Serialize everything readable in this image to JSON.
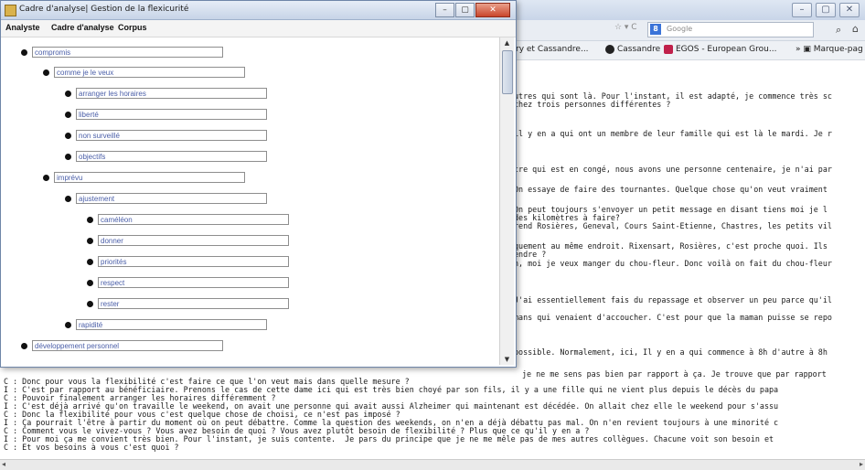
{
  "browser": {
    "window_controls": [
      "–",
      "▢",
      "✕"
    ],
    "url_tail": "☆ ▾ C",
    "search_placeholder": "Google",
    "bookmarks": [
      {
        "label": "ry et Cassandre...",
        "color": ""
      },
      {
        "label": "Cassandre",
        "color": "#222222"
      },
      {
        "label": "EGOS - European Grou...",
        "color": "#c0204a"
      },
      {
        "label": "» ▣ Marque-pag",
        "color": ""
      }
    ],
    "right_lines": [
      "utres qui sont là. Pour l'instant, il est adapté, je commence très sc",
      "chez trois personnes différentes ?",
      "il y en a qui ont un membre de leur famille qui est là le mardi. Je r",
      "tre qui est en congé, nous avons une personne centenaire, je n'ai par",
      "On essaye de faire des tournantes. Quelque chose qu'on veut vraiment",
      "On peut toujours s'envoyer un petit message en disant tiens moi je l",
      "des kilomètres à faire?",
      "rend Rosières, Geneval, Cours Saint-Etienne, Chastres, les petits vil",
      "quement au même endroit. Rixensart, Rosières, c'est proche quoi. Ils",
      "endre ?",
      "n, moi je veux manger du chou-fleur. Donc voilà on fait du chou-fleur",
      "J'ai essentiellement fais du repassage et observer un peu parce qu'il",
      "mans qui venaient d'accoucher. C'est pour que la maman puisse se repo",
      "possible. Normalement, ici, Il y en a qui commence à 8h d'autre à 8h"
    ],
    "bottom_lines": [
      "C : Donc pour vous la flexibilité c'est faire ce que l'on veut mais dans quelle mesure ?",
      "I : C'est par rapport au bénéficiaire. Prenons le cas de cette dame ici qui est très bien choyé par son fils, il y a une fille qui ne vient plus depuis le décès du papa",
      "C : Pouvoir finalement arranger les horaires différemment ?",
      "I : C'est déjà arrivé qu'on travaille le weekend, on avait une personne qui avait aussi Alzheimer qui maintenant est décédée. On allait chez elle le weekend pour s'assu",
      "C : Donc la flexibilité pour vous c'est quelque chose de choisi, ce n'est pas imposé ?",
      "I : Ça pourrait l'être à partir du moment où on peut débattre. Comme la question des weekends, on n'en a déjà débattu pas mal. On n'en revient toujours à une minorité c",
      "C : Comment vous le vivez-vous ? Vous avez besoin de quoi ? Vous avez plutôt besoin de flexibilité ? Plus que ce qu'il y en a ?",
      "I : Pour moi ça me convient très bien. Pour l'instant, je suis contente.  Je pars du principe que je ne me mêle pas de mes autres collègues. Chacune voit son besoin et",
      "C : Et vos besoins à vous c'est quoi ?"
    ],
    "overlap_line": "je ne me sens pas bien par rapport à ça. Je trouve que par rapport"
  },
  "app": {
    "title": "Cadre d'analyse| Gestion de la flexicurité",
    "window_controls": [
      "–",
      "▢",
      "✕"
    ],
    "menu": [
      "Analyste",
      "Cadre d'analyse",
      "Corpus"
    ],
    "tree": [
      {
        "label": "compromis",
        "level": 0
      },
      {
        "label": "comme je le veux",
        "level": 1
      },
      {
        "label": "arranger les horaires",
        "level": 2
      },
      {
        "label": "liberté",
        "level": 2
      },
      {
        "label": "non surveillé",
        "level": 2
      },
      {
        "label": "objectifs",
        "level": 2
      },
      {
        "label": "imprévu",
        "level": 1
      },
      {
        "label": "ajustement",
        "level": 2
      },
      {
        "label": "caméléon",
        "level": 3
      },
      {
        "label": "donner",
        "level": 3
      },
      {
        "label": "priorités",
        "level": 3
      },
      {
        "label": "respect",
        "level": 3
      },
      {
        "label": "rester",
        "level": 3
      },
      {
        "label": "rapidité",
        "level": 2
      },
      {
        "label": "développement personnel",
        "level": 0
      }
    ],
    "scroll": {
      "up": "▲",
      "down": "▼"
    }
  }
}
